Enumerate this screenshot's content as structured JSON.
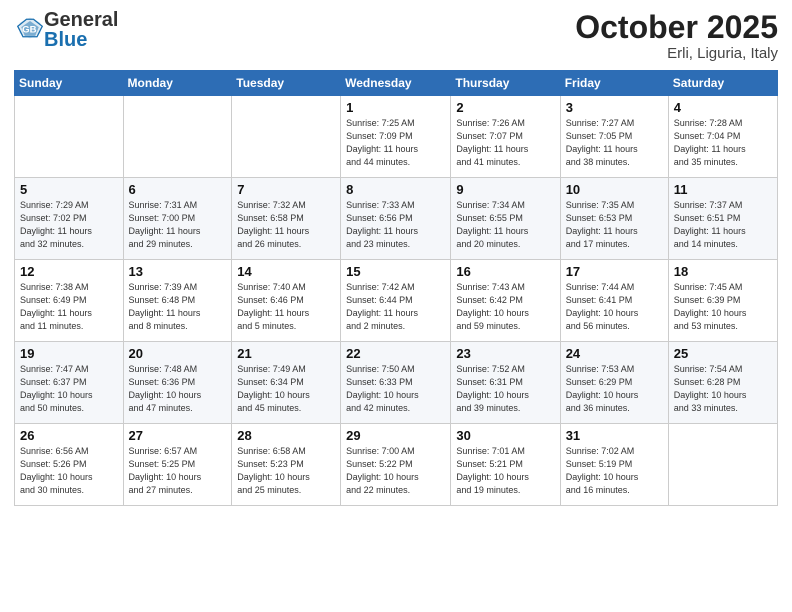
{
  "logo": {
    "general": "General",
    "blue": "Blue"
  },
  "title": {
    "month": "October 2025",
    "location": "Erli, Liguria, Italy"
  },
  "days_of_week": [
    "Sunday",
    "Monday",
    "Tuesday",
    "Wednesday",
    "Thursday",
    "Friday",
    "Saturday"
  ],
  "weeks": [
    [
      {
        "day": "",
        "info": ""
      },
      {
        "day": "",
        "info": ""
      },
      {
        "day": "",
        "info": ""
      },
      {
        "day": "1",
        "info": "Sunrise: 7:25 AM\nSunset: 7:09 PM\nDaylight: 11 hours\nand 44 minutes."
      },
      {
        "day": "2",
        "info": "Sunrise: 7:26 AM\nSunset: 7:07 PM\nDaylight: 11 hours\nand 41 minutes."
      },
      {
        "day": "3",
        "info": "Sunrise: 7:27 AM\nSunset: 7:05 PM\nDaylight: 11 hours\nand 38 minutes."
      },
      {
        "day": "4",
        "info": "Sunrise: 7:28 AM\nSunset: 7:04 PM\nDaylight: 11 hours\nand 35 minutes."
      }
    ],
    [
      {
        "day": "5",
        "info": "Sunrise: 7:29 AM\nSunset: 7:02 PM\nDaylight: 11 hours\nand 32 minutes."
      },
      {
        "day": "6",
        "info": "Sunrise: 7:31 AM\nSunset: 7:00 PM\nDaylight: 11 hours\nand 29 minutes."
      },
      {
        "day": "7",
        "info": "Sunrise: 7:32 AM\nSunset: 6:58 PM\nDaylight: 11 hours\nand 26 minutes."
      },
      {
        "day": "8",
        "info": "Sunrise: 7:33 AM\nSunset: 6:56 PM\nDaylight: 11 hours\nand 23 minutes."
      },
      {
        "day": "9",
        "info": "Sunrise: 7:34 AM\nSunset: 6:55 PM\nDaylight: 11 hours\nand 20 minutes."
      },
      {
        "day": "10",
        "info": "Sunrise: 7:35 AM\nSunset: 6:53 PM\nDaylight: 11 hours\nand 17 minutes."
      },
      {
        "day": "11",
        "info": "Sunrise: 7:37 AM\nSunset: 6:51 PM\nDaylight: 11 hours\nand 14 minutes."
      }
    ],
    [
      {
        "day": "12",
        "info": "Sunrise: 7:38 AM\nSunset: 6:49 PM\nDaylight: 11 hours\nand 11 minutes."
      },
      {
        "day": "13",
        "info": "Sunrise: 7:39 AM\nSunset: 6:48 PM\nDaylight: 11 hours\nand 8 minutes."
      },
      {
        "day": "14",
        "info": "Sunrise: 7:40 AM\nSunset: 6:46 PM\nDaylight: 11 hours\nand 5 minutes."
      },
      {
        "day": "15",
        "info": "Sunrise: 7:42 AM\nSunset: 6:44 PM\nDaylight: 11 hours\nand 2 minutes."
      },
      {
        "day": "16",
        "info": "Sunrise: 7:43 AM\nSunset: 6:42 PM\nDaylight: 10 hours\nand 59 minutes."
      },
      {
        "day": "17",
        "info": "Sunrise: 7:44 AM\nSunset: 6:41 PM\nDaylight: 10 hours\nand 56 minutes."
      },
      {
        "day": "18",
        "info": "Sunrise: 7:45 AM\nSunset: 6:39 PM\nDaylight: 10 hours\nand 53 minutes."
      }
    ],
    [
      {
        "day": "19",
        "info": "Sunrise: 7:47 AM\nSunset: 6:37 PM\nDaylight: 10 hours\nand 50 minutes."
      },
      {
        "day": "20",
        "info": "Sunrise: 7:48 AM\nSunset: 6:36 PM\nDaylight: 10 hours\nand 47 minutes."
      },
      {
        "day": "21",
        "info": "Sunrise: 7:49 AM\nSunset: 6:34 PM\nDaylight: 10 hours\nand 45 minutes."
      },
      {
        "day": "22",
        "info": "Sunrise: 7:50 AM\nSunset: 6:33 PM\nDaylight: 10 hours\nand 42 minutes."
      },
      {
        "day": "23",
        "info": "Sunrise: 7:52 AM\nSunset: 6:31 PM\nDaylight: 10 hours\nand 39 minutes."
      },
      {
        "day": "24",
        "info": "Sunrise: 7:53 AM\nSunset: 6:29 PM\nDaylight: 10 hours\nand 36 minutes."
      },
      {
        "day": "25",
        "info": "Sunrise: 7:54 AM\nSunset: 6:28 PM\nDaylight: 10 hours\nand 33 minutes."
      }
    ],
    [
      {
        "day": "26",
        "info": "Sunrise: 6:56 AM\nSunset: 5:26 PM\nDaylight: 10 hours\nand 30 minutes."
      },
      {
        "day": "27",
        "info": "Sunrise: 6:57 AM\nSunset: 5:25 PM\nDaylight: 10 hours\nand 27 minutes."
      },
      {
        "day": "28",
        "info": "Sunrise: 6:58 AM\nSunset: 5:23 PM\nDaylight: 10 hours\nand 25 minutes."
      },
      {
        "day": "29",
        "info": "Sunrise: 7:00 AM\nSunset: 5:22 PM\nDaylight: 10 hours\nand 22 minutes."
      },
      {
        "day": "30",
        "info": "Sunrise: 7:01 AM\nSunset: 5:21 PM\nDaylight: 10 hours\nand 19 minutes."
      },
      {
        "day": "31",
        "info": "Sunrise: 7:02 AM\nSunset: 5:19 PM\nDaylight: 10 hours\nand 16 minutes."
      },
      {
        "day": "",
        "info": ""
      }
    ]
  ]
}
